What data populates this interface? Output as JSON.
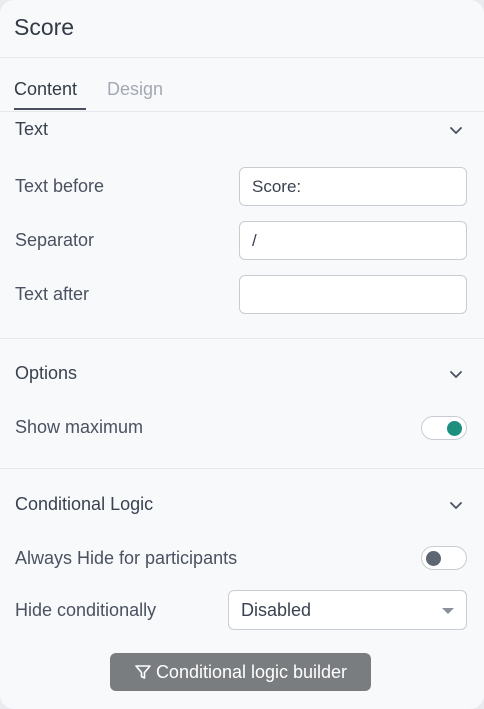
{
  "panel": {
    "title": "Score"
  },
  "tabs": [
    {
      "label": "Content",
      "active": true
    },
    {
      "label": "Design",
      "active": false
    }
  ],
  "sections": {
    "text": {
      "title": "Text",
      "fields": {
        "text_before": {
          "label": "Text before",
          "value": "Score:"
        },
        "separator": {
          "label": "Separator",
          "value": "/"
        },
        "text_after": {
          "label": "Text after",
          "value": ""
        }
      }
    },
    "options": {
      "title": "Options",
      "show_maximum": {
        "label": "Show maximum",
        "on": true
      }
    },
    "conditional": {
      "title": "Conditional Logic",
      "always_hide": {
        "label": "Always Hide for participants",
        "on": false
      },
      "hide_conditionally": {
        "label": "Hide conditionally",
        "value": "Disabled"
      },
      "builder_button": {
        "label": "Conditional logic builder"
      }
    }
  },
  "colors": {
    "toggle_on": "#1d8f7f",
    "toggle_off": "#5f6673",
    "button_bg": "#7a7d80"
  },
  "icons": [
    "chevron-down-icon",
    "filter-icon"
  ]
}
